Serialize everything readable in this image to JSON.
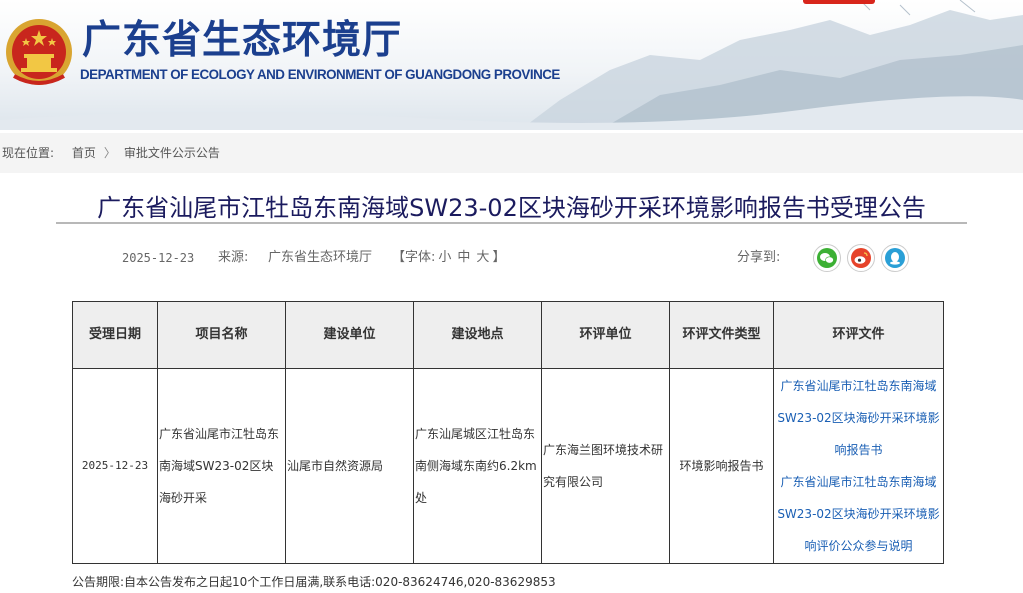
{
  "header": {
    "title_cn": "广东省生态环境厅",
    "title_en": "DEPARTMENT OF ECOLOGY AND ENVIRONMENT OF GUANGDONG PROVINCE"
  },
  "breadcrumb": {
    "label": "现在位置:",
    "home": "首页",
    "separator": "〉",
    "current": "审批文件公示公告"
  },
  "article": {
    "title": "广东省汕尾市江牡岛东南海域SW23-02区块海砂开采环境影响报告书受理公告",
    "date": "2025-12-23",
    "source_label": "来源:",
    "source": "广东省生态环境厅",
    "font_label_open": "【字体:",
    "font_small": "小",
    "font_medium": "中",
    "font_large": "大",
    "font_label_close": "】",
    "share_label": "分享到:"
  },
  "table": {
    "headers": [
      "受理日期",
      "项目名称",
      "建设单位",
      "建设地点",
      "环评单位",
      "环评文件类型",
      "环评文件"
    ],
    "row": {
      "date": "2025-12-23",
      "project": "广东省汕尾市江牡岛东南海域SW23-02区块海砂开采",
      "builder": "汕尾市自然资源局",
      "location": "广东汕尾城区江牡岛东南侧海域东南约6.2km处",
      "eia_unit": "广东海兰图环境技术研究有限公司",
      "doc_type": "环境影响报告书",
      "files": [
        "广东省汕尾市江牡岛东南海域SW23-02区块海砂开采环境影响报告书",
        "广东省汕尾市江牡岛东南海域SW23-02区块海砂开采环境影响评价公众参与说明"
      ]
    }
  },
  "footer": {
    "note": "公告期限:自本公告发布之日起10个工作日届满,联系电话:020-83624746,020-83629853"
  },
  "colors": {
    "brand_blue": "#1b3f8e",
    "title_navy": "#1b1b5e",
    "link_blue": "#1a5fb4",
    "wechat_green": "#3cb034",
    "weibo_red": "#e6432a",
    "qq_blue": "#2a9fd6"
  },
  "icons": {
    "emblem": "national-emblem-icon",
    "wechat": "wechat-icon",
    "weibo": "weibo-icon",
    "qq": "qq-icon"
  }
}
